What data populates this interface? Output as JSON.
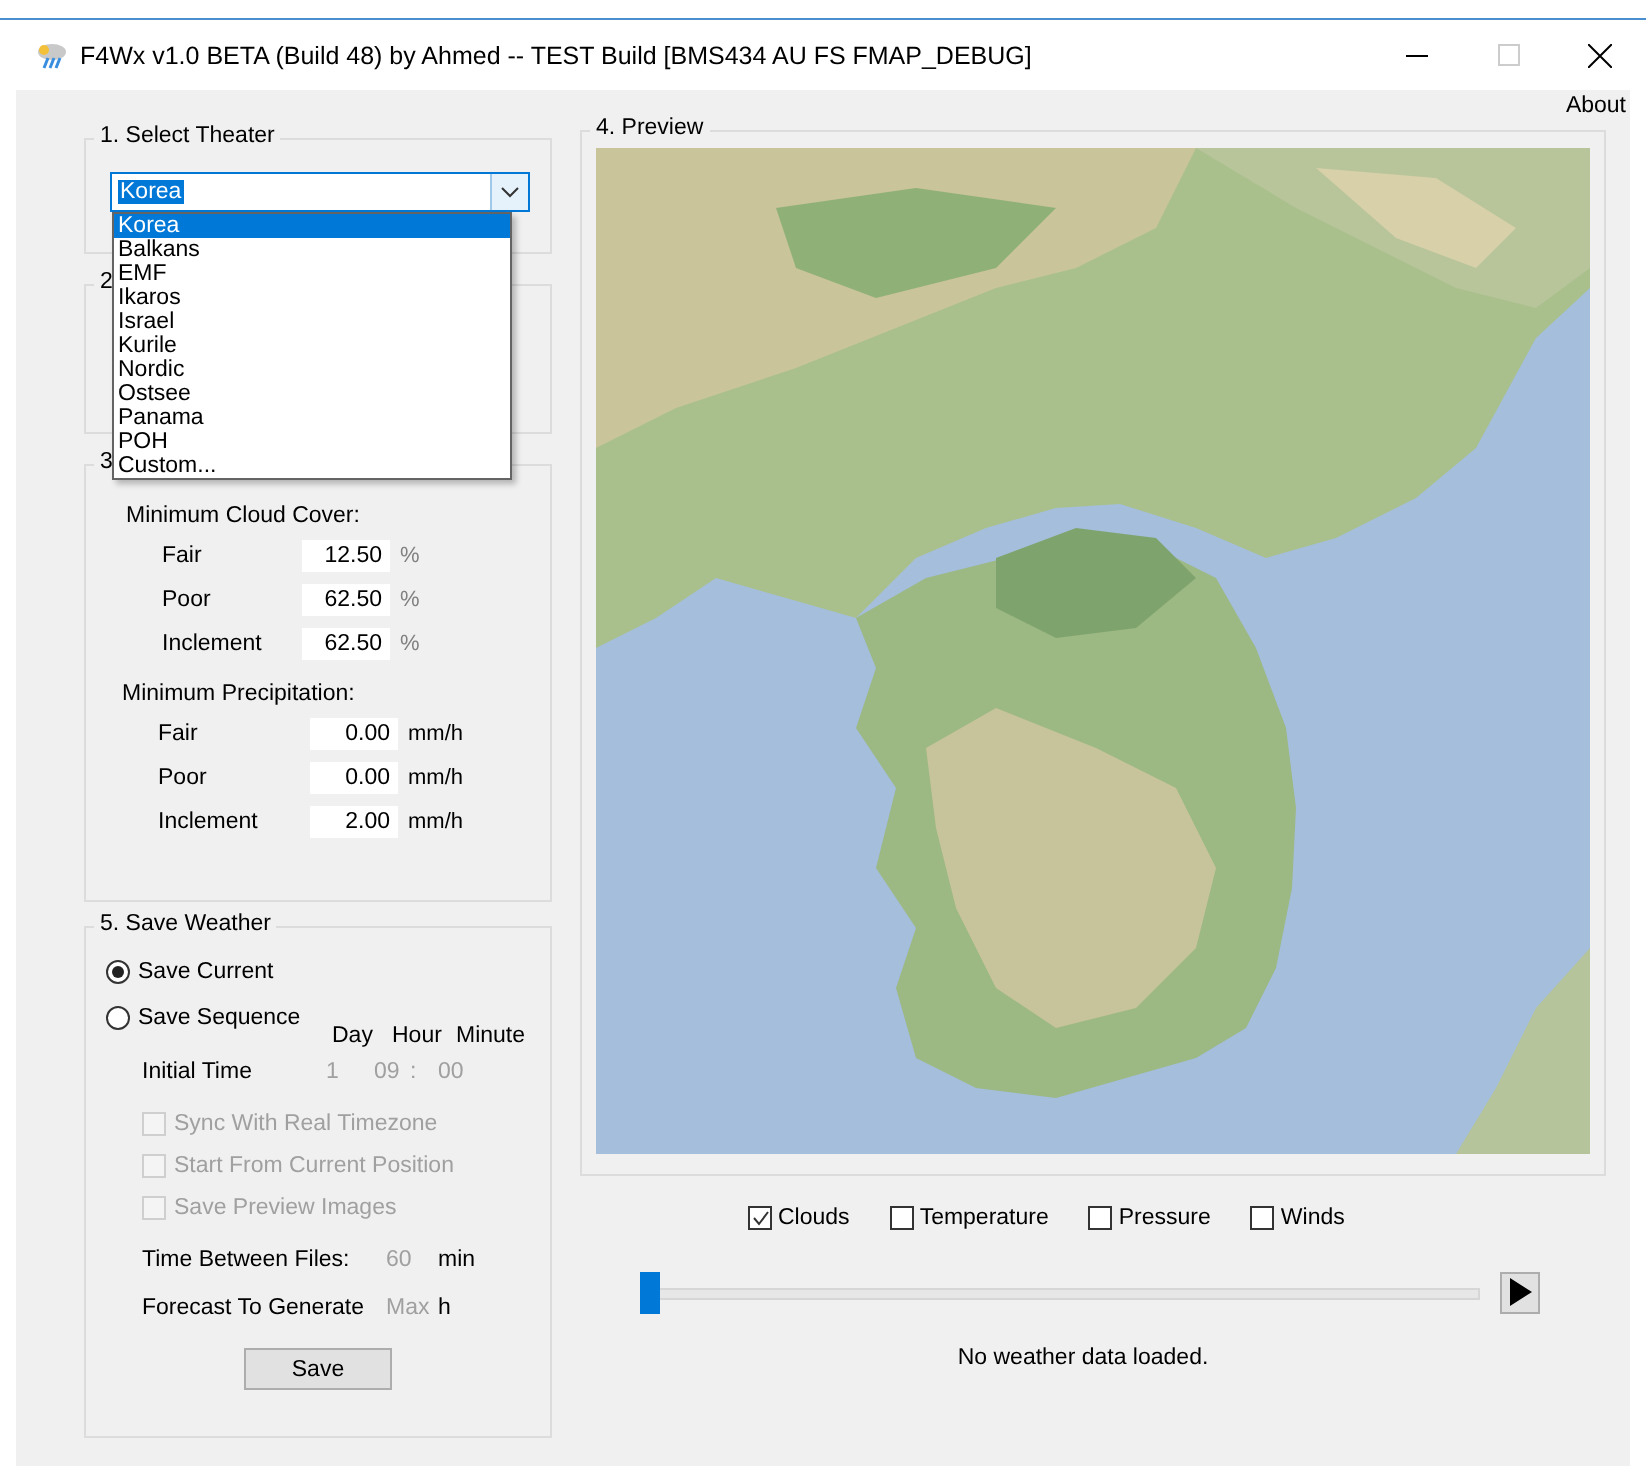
{
  "window": {
    "title": "F4Wx v1.0 BETA (Build 48) by Ahmed -- TEST Build [BMS434 AU FS FMAP_DEBUG]"
  },
  "menu": {
    "about": "About"
  },
  "theater": {
    "title": "1. Select Theater",
    "value": "Korea",
    "expanded": true,
    "options": [
      {
        "label": "Korea",
        "selected": true
      },
      {
        "label": "Balkans",
        "selected": false
      },
      {
        "label": "EMF",
        "selected": false
      },
      {
        "label": "Ikaros",
        "selected": false
      },
      {
        "label": "Israel",
        "selected": false
      },
      {
        "label": "Kurile",
        "selected": false
      },
      {
        "label": "Nordic",
        "selected": false
      },
      {
        "label": "Ostsee",
        "selected": false
      },
      {
        "label": "Panama",
        "selected": false
      },
      {
        "label": "POH",
        "selected": false
      },
      {
        "label": "Custom...",
        "selected": false
      }
    ]
  },
  "group_2": {
    "title": "2"
  },
  "thresholds": {
    "title": "3",
    "cloud_label": "Minimum Cloud Cover:",
    "cloud_rows": [
      {
        "label": "Fair",
        "value": "12.50",
        "unit": "%"
      },
      {
        "label": "Poor",
        "value": "62.50",
        "unit": "%"
      },
      {
        "label": "Inclement",
        "value": "62.50",
        "unit": "%"
      }
    ],
    "precip_label": "Minimum Precipitation:",
    "precip_rows": [
      {
        "label": "Fair",
        "value": "0.00",
        "unit": "mm/h"
      },
      {
        "label": "Poor",
        "value": "0.00",
        "unit": "mm/h"
      },
      {
        "label": "Inclement",
        "value": "2.00",
        "unit": "mm/h"
      }
    ]
  },
  "save": {
    "title": "5. Save Weather",
    "modes": [
      {
        "label": "Save Current",
        "selected": true
      },
      {
        "label": "Save Sequence",
        "selected": false
      }
    ],
    "time_headers": [
      "Day",
      "Hour",
      "Minute"
    ],
    "initial_time_label": "Initial Time",
    "day": "1",
    "hour": "09",
    "separator": ":",
    "minute": "00",
    "options": [
      {
        "label": "Sync With Real Timezone",
        "checked": false,
        "disabled": true
      },
      {
        "label": "Start From Current Position",
        "checked": false,
        "disabled": true
      },
      {
        "label": "Save Preview Images",
        "checked": false,
        "disabled": true
      }
    ],
    "between_label": "Time Between Files:",
    "between_value": "60",
    "between_unit": "min",
    "forecast_label": "Forecast To Generate",
    "forecast_value": "Max",
    "forecast_unit": "h",
    "button": "Save"
  },
  "preview": {
    "title": "4. Preview",
    "layers": [
      {
        "label": "Clouds",
        "checked": true
      },
      {
        "label": "Temperature",
        "checked": false
      },
      {
        "label": "Pressure",
        "checked": false
      },
      {
        "label": "Winds",
        "checked": false
      }
    ],
    "timeline": {
      "level": 0
    },
    "status": "No weather data loaded."
  }
}
